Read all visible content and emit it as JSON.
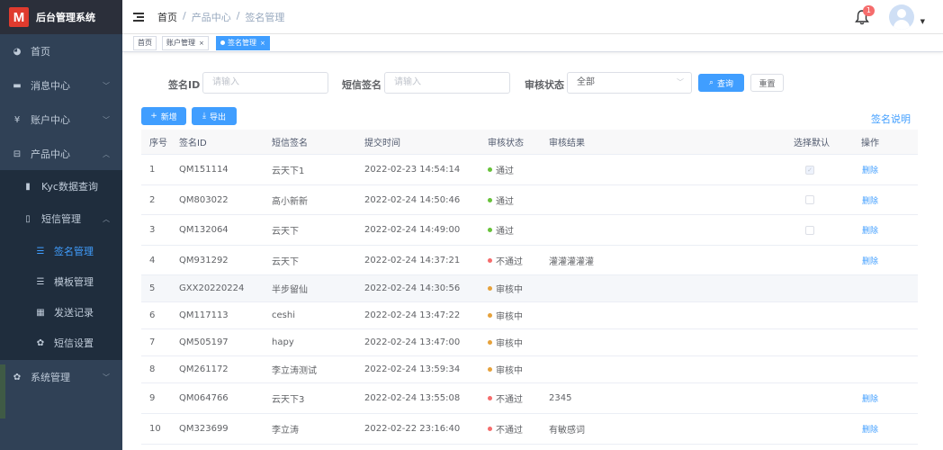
{
  "app": {
    "logo_letter": "M",
    "title": "后台管理系统"
  },
  "sidebar": {
    "items": [
      {
        "label": "首页",
        "icon": "dashboard-icon",
        "glyph": "◕"
      },
      {
        "label": "消息中心",
        "icon": "message-icon",
        "glyph": "▬",
        "arrow": "﹀"
      },
      {
        "label": "账户中心",
        "icon": "yen-icon",
        "glyph": "¥",
        "arrow": "﹀"
      },
      {
        "label": "产品中心",
        "icon": "briefcase-icon",
        "glyph": "⊟",
        "arrow": "︿"
      },
      {
        "label": "Kyc数据查询",
        "icon": "bar-chart-icon",
        "glyph": "▮"
      },
      {
        "label": "短信管理",
        "icon": "phone-icon",
        "glyph": "▯",
        "arrow": "︿"
      },
      {
        "label": "签名管理",
        "icon": "list-icon",
        "glyph": "☰"
      },
      {
        "label": "模板管理",
        "icon": "list-icon",
        "glyph": "☰"
      },
      {
        "label": "发送记录",
        "icon": "grid-icon",
        "glyph": "▦"
      },
      {
        "label": "短信设置",
        "icon": "gear-icon",
        "glyph": "✿"
      },
      {
        "label": "系统管理",
        "icon": "gear-icon",
        "glyph": "✿",
        "arrow": "﹀"
      }
    ]
  },
  "header": {
    "breadcrumb": [
      "首页",
      "/",
      "产品中心",
      "/",
      "签名管理"
    ],
    "notification_count": "1"
  },
  "tabs": [
    {
      "label": "首页"
    },
    {
      "label": "账户管理",
      "close": "×"
    },
    {
      "label": "签名管理",
      "close": "×"
    }
  ],
  "search": {
    "id_label": "签名ID",
    "id_placeholder": "请输入",
    "sign_label": "短信签名",
    "sign_placeholder": "请输入",
    "status_label": "审核状态",
    "status_value": "全部",
    "query_label": "查询",
    "reset_label": "重置"
  },
  "toolbar": {
    "add_label": "新增",
    "export_label": "导出",
    "help_link": "签名说明"
  },
  "colors": {
    "pass": "#67c23a",
    "fail": "#f56c6c",
    "pending": "#e6a23c",
    "primary": "#409eff",
    "sidebar": "#304156"
  },
  "table": {
    "headers": [
      "序号",
      "签名ID",
      "短信签名",
      "提交时间",
      "审核状态",
      "审核结果",
      "选择默认",
      "操作"
    ],
    "rows": [
      {
        "no": "1",
        "id": "QM151114",
        "sign": "云天下1",
        "time": "2022-02-23 14:54:14",
        "status": "通过",
        "state": "pass",
        "result": "",
        "checkbox": "checked",
        "action": "删除"
      },
      {
        "no": "2",
        "id": "QM803022",
        "sign": "高小新新",
        "time": "2022-02-24 14:50:46",
        "status": "通过",
        "state": "pass",
        "result": "",
        "checkbox": "empty",
        "action": "删除"
      },
      {
        "no": "3",
        "id": "QM132064",
        "sign": "云天下",
        "time": "2022-02-24 14:49:00",
        "status": "通过",
        "state": "pass",
        "result": "",
        "checkbox": "empty",
        "action": "删除"
      },
      {
        "no": "4",
        "id": "QM931292",
        "sign": "云天下",
        "time": "2022-02-24 14:37:21",
        "status": "不通过",
        "state": "fail",
        "result": "灌灌灌灌灌",
        "checkbox": "none",
        "action": "删除"
      },
      {
        "no": "5",
        "id": "GXX20220224",
        "sign": "半步留仙",
        "time": "2022-02-24 14:30:56",
        "status": "审核中",
        "state": "pending",
        "result": "",
        "checkbox": "none",
        "action": ""
      },
      {
        "no": "6",
        "id": "QM117113",
        "sign": "ceshi",
        "time": "2022-02-24 13:47:22",
        "status": "审核中",
        "state": "pending",
        "result": "",
        "checkbox": "none",
        "action": ""
      },
      {
        "no": "7",
        "id": "QM505197",
        "sign": "hapy",
        "time": "2022-02-24 13:47:00",
        "status": "审核中",
        "state": "pending",
        "result": "",
        "checkbox": "none",
        "action": ""
      },
      {
        "no": "8",
        "id": "QM261172",
        "sign": "李立涛测试",
        "time": "2022-02-24 13:59:34",
        "status": "审核中",
        "state": "pending",
        "result": "",
        "checkbox": "none",
        "action": ""
      },
      {
        "no": "9",
        "id": "QM064766",
        "sign": "云天下3",
        "time": "2022-02-24 13:55:08",
        "status": "不通过",
        "state": "fail",
        "result": "2345",
        "checkbox": "none",
        "action": "删除"
      },
      {
        "no": "10",
        "id": "QM323699",
        "sign": "李立涛",
        "time": "2022-02-22 23:16:40",
        "status": "不通过",
        "state": "fail",
        "result": "有敏感词",
        "checkbox": "none",
        "action": "删除"
      }
    ]
  }
}
